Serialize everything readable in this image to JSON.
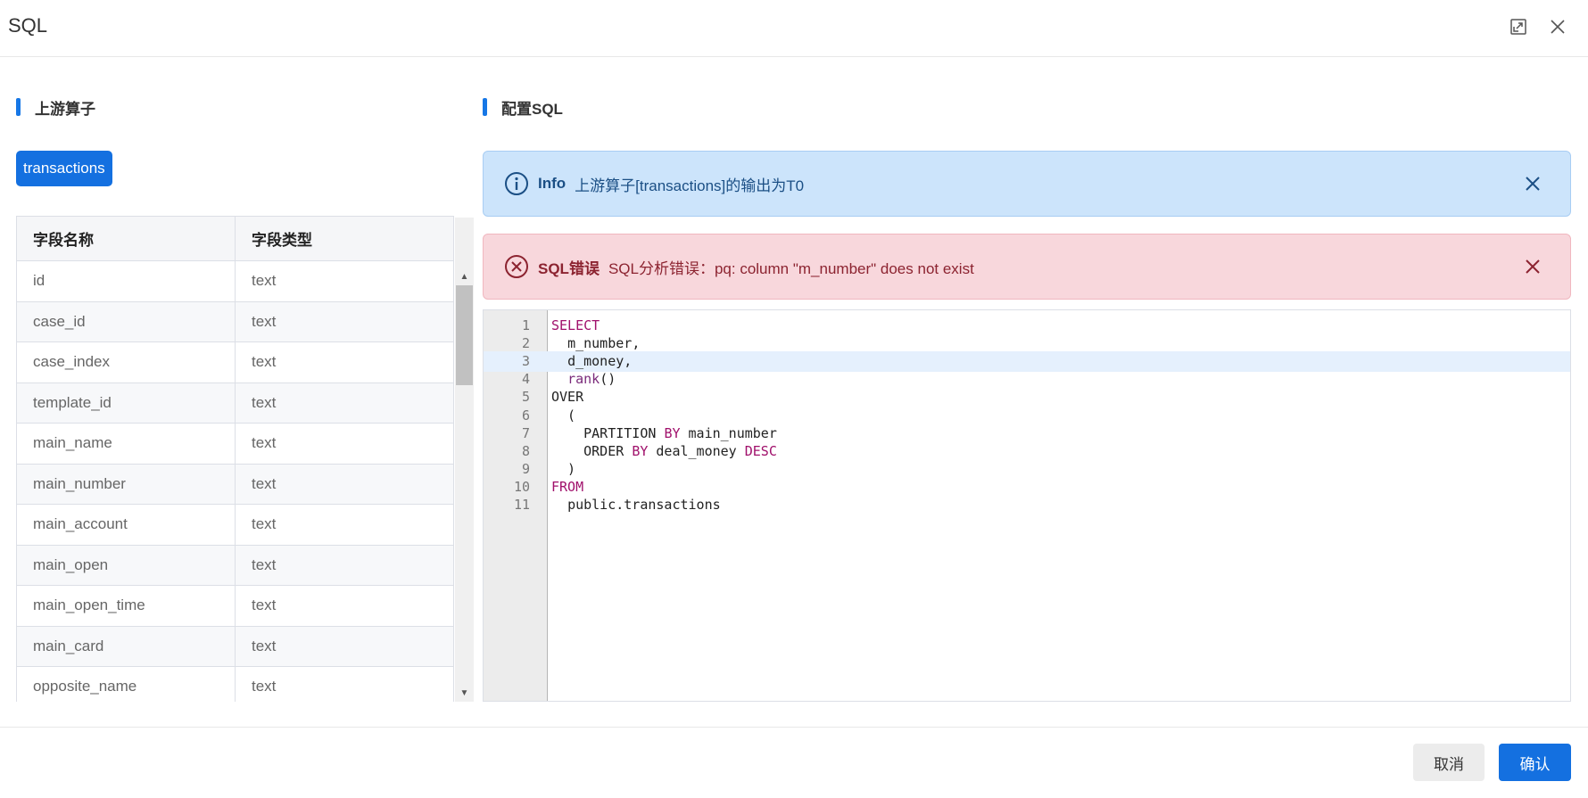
{
  "dialog": {
    "title": "SQL"
  },
  "left": {
    "section_title": "上游算子",
    "operator_tag": "transactions",
    "table": {
      "headers": [
        "字段名称",
        "字段类型"
      ],
      "rows": [
        [
          "id",
          "text"
        ],
        [
          "case_id",
          "text"
        ],
        [
          "case_index",
          "text"
        ],
        [
          "template_id",
          "text"
        ],
        [
          "main_name",
          "text"
        ],
        [
          "main_number",
          "text"
        ],
        [
          "main_account",
          "text"
        ],
        [
          "main_open",
          "text"
        ],
        [
          "main_open_time",
          "text"
        ],
        [
          "main_card",
          "text"
        ],
        [
          "opposite_name",
          "text"
        ]
      ]
    }
  },
  "right": {
    "section_title": "配置SQL",
    "info_alert": {
      "title": "Info",
      "message": "上游算子[transactions]的输出为T0"
    },
    "error_alert": {
      "title": "SQL错误",
      "message": "SQL分析错误：pq: column \"m_number\" does not exist"
    },
    "editor": {
      "active_line": 3,
      "lines": [
        {
          "n": "1",
          "code": "SELECT"
        },
        {
          "n": "2",
          "code": "  m_number,"
        },
        {
          "n": "3",
          "code": "  d_money,"
        },
        {
          "n": "4",
          "code": "  rank()"
        },
        {
          "n": "5",
          "code": "OVER"
        },
        {
          "n": "6",
          "code": "  ("
        },
        {
          "n": "7",
          "code": "    PARTITION BY main_number"
        },
        {
          "n": "8",
          "code": "    ORDER BY deal_money DESC"
        },
        {
          "n": "9",
          "code": "  )"
        },
        {
          "n": "10",
          "code": "FROM"
        },
        {
          "n": "11",
          "code": "  public.transactions"
        }
      ]
    }
  },
  "footer": {
    "cancel_label": "取消",
    "confirm_label": "确认"
  },
  "colors": {
    "primary": "#1470e0",
    "info_bg": "#cce4fb",
    "error_bg": "#f8d7dc",
    "keyword": "#a0106b"
  }
}
